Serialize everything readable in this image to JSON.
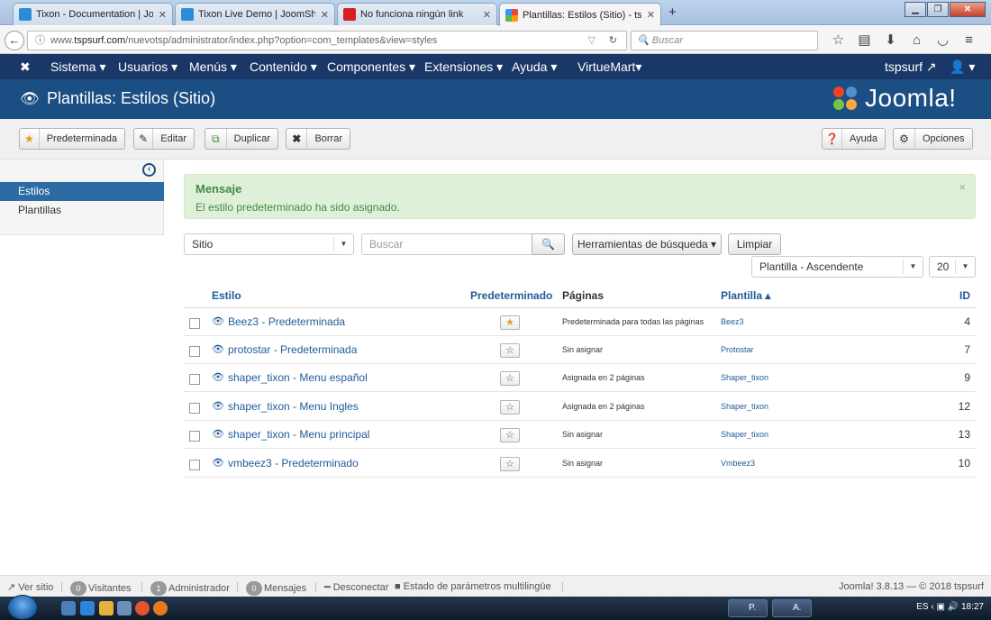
{
  "browser": {
    "tabs": [
      {
        "title": "Tixon - Documentation | Jo...",
        "active": false,
        "icon": "joomshaper-icon"
      },
      {
        "title": "Tixon Live Demo | JoomSh...",
        "active": false,
        "icon": "joomshaper-icon"
      },
      {
        "title": "No funciona ningún link",
        "active": false,
        "icon": "w-icon"
      },
      {
        "title": "Plantillas: Estilos (Sitio) - ts...",
        "active": true,
        "icon": "joomla-icon"
      }
    ],
    "new_tab": "+",
    "url": {
      "prefix": "www.",
      "host": "tspsurf.com",
      "path": "/nuevotsp/administrator/index.php?option=com_templates&view=styles"
    },
    "search_placeholder": "Buscar"
  },
  "joomla_menu": {
    "items": [
      "Sistema ▾",
      "Usuarios ▾",
      "Menús ▾",
      "Contenido ▾",
      "Componentes ▾",
      "Extensiones ▾",
      "Ayuda ▾",
      "VirtueMart▾"
    ],
    "user": "tspsurf",
    "account": "▾"
  },
  "header": {
    "title": "Plantillas: Estilos (Sitio)",
    "logo_text": "Joomla!"
  },
  "toolbar": {
    "default_label": "Predeterminada",
    "edit_label": "Editar",
    "duplicate_label": "Duplicar",
    "delete_label": "Borrar",
    "help_label": "Ayuda",
    "options_label": "Opciones"
  },
  "sidebar": {
    "items": [
      {
        "label": "Estilos",
        "active": true
      },
      {
        "label": "Plantillas",
        "active": false
      }
    ]
  },
  "alert": {
    "heading": "Mensaje",
    "message": "El estilo predeterminado ha sido asignado.",
    "close": "×"
  },
  "filters": {
    "client": "Sitio",
    "search_placeholder": "Buscar",
    "tools_label": "Herramientas de búsqueda ▾",
    "clear_label": "Limpiar",
    "ordering": "Plantilla - Ascendente",
    "limit": "20"
  },
  "table": {
    "headers": {
      "style": "Estilo",
      "default": "Predeterminado",
      "pages": "Páginas",
      "template": "Plantilla ▴",
      "id": "ID"
    },
    "rows": [
      {
        "name": "Beez3 - Predeterminada",
        "is_default": true,
        "pages": "Predeterminada para todas las páginas",
        "template": "Beez3",
        "id": "4"
      },
      {
        "name": "protostar - Predeterminada",
        "is_default": false,
        "pages": "Sin asignar",
        "template": "Protostar",
        "id": "7"
      },
      {
        "name": "shaper_tixon - Menu español",
        "is_default": false,
        "pages": "Asignada en 2 páginas",
        "template": "Shaper_tixon",
        "id": "9"
      },
      {
        "name": "shaper_tixon - Menu Ingles",
        "is_default": false,
        "pages": "Asignada en 2 páginas",
        "template": "Shaper_tixon",
        "id": "12"
      },
      {
        "name": "shaper_tixon - Menu principal",
        "is_default": false,
        "pages": "Sin asignar",
        "template": "Shaper_tixon",
        "id": "13"
      },
      {
        "name": "vmbeez3 - Predeterminado",
        "is_default": false,
        "pages": "Sin asignar",
        "template": "Vmbeez3",
        "id": "10"
      }
    ]
  },
  "status": {
    "view_site": "Ver sitio",
    "visitors_count": "0",
    "visitors": "Visitantes",
    "admin_count": "1",
    "admin": "Administrador",
    "messages_count": "0",
    "messages": "Mensajes",
    "logout": "Desconectar",
    "multilang": "Estado de parámetros multilingüe",
    "version": "Joomla! 3.8.13 — © 2018 tspsurf"
  },
  "taskbar": {
    "app1": "P.",
    "app2": "A.",
    "lang": "ES",
    "clock": "18:27"
  },
  "colors": {
    "topbar": "#1a3867",
    "header": "#1b4e82",
    "link": "#1f5b98",
    "alert_bg": "#dff0d8",
    "star": "#e49a27"
  }
}
